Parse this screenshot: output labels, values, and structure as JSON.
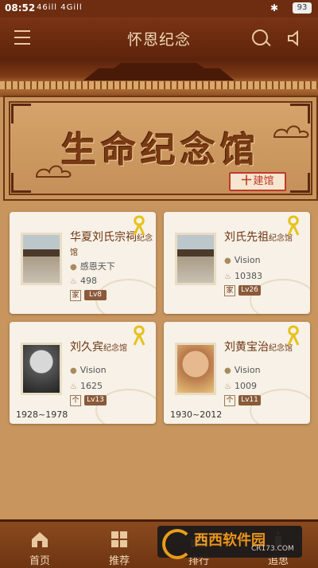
{
  "status_bar": {
    "time": "08:52",
    "signal_text": "46ill 4Gill",
    "battery": "93"
  },
  "app_bar": {
    "title": "怀恩纪念"
  },
  "banner": {
    "title": "生命纪念馆",
    "build_button": {
      "plus": "十",
      "label": "建馆"
    }
  },
  "memorials": [
    {
      "name": "华夏刘氏宗祠",
      "suffix": "纪念馆",
      "creator": "感恩天下",
      "count": "498",
      "tag": "家",
      "level": "Lv8",
      "dates": ""
    },
    {
      "name": "刘氏先祖",
      "suffix": "纪念馆",
      "creator": "Vision",
      "count": "10383",
      "tag": "家",
      "level": "Lv26",
      "dates": ""
    },
    {
      "name": "刘久宾",
      "suffix": "纪念馆",
      "creator": "Vision",
      "count": "1625",
      "tag": "个",
      "level": "Lv13",
      "dates": "1928~1978"
    },
    {
      "name": "刘黄宝治",
      "suffix": "纪念馆",
      "creator": "Vision",
      "count": "1009",
      "tag": "个",
      "level": "Lv11",
      "dates": "1930~2012"
    }
  ],
  "bottom_nav": {
    "items": [
      "首页",
      "推荐",
      "排行",
      "追思"
    ]
  },
  "watermark": {
    "main": "西西软件园",
    "sub": "CR173.COM"
  },
  "colors": {
    "brand_dark": "#6e2d10",
    "wood": "#c8955e",
    "accent_red": "#c0392b",
    "level_badge": "#8a5a3a"
  }
}
